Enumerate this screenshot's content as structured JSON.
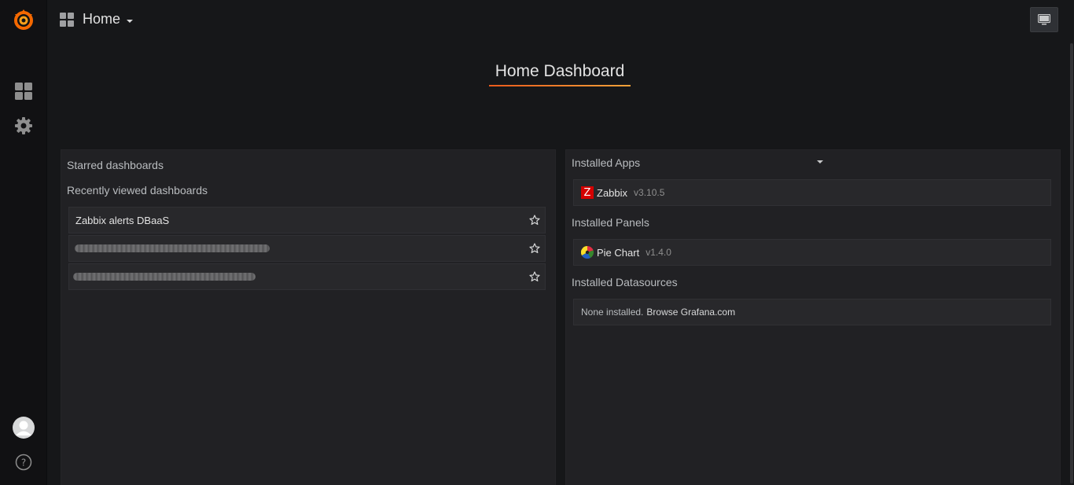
{
  "topbar": {
    "dashboard_title": "Home"
  },
  "heading": {
    "title": "Home Dashboard"
  },
  "left_panel": {
    "starred_title": "Starred dashboards",
    "recent_title": "Recently viewed dashboards",
    "recent_items": [
      {
        "name": "Zabbix alerts DBaaS"
      },
      {
        "name": ""
      },
      {
        "name": ""
      }
    ]
  },
  "right_panel": {
    "apps_title": "Installed Apps",
    "apps": [
      {
        "name": "Zabbix",
        "version": "v3.10.5"
      }
    ],
    "panels_title": "Installed Panels",
    "panels": [
      {
        "name": "Pie Chart",
        "version": "v1.4.0"
      }
    ],
    "datasources_title": "Installed Datasources",
    "datasources_empty": "None installed.",
    "datasources_link": "Browse Grafana.com"
  },
  "colors": {
    "brand_orange": "#eb5b1c",
    "zabbix_red": "#d40000",
    "background": "#161719",
    "panel": "#212124"
  },
  "icons": [
    "grafana-logo-icon",
    "dashboards-icon",
    "gear-icon",
    "avatar-icon",
    "help-icon",
    "grid-icon",
    "chevron-down-icon",
    "monitor-icon",
    "star-icon",
    "zabbix-icon",
    "pie-chart-icon"
  ]
}
